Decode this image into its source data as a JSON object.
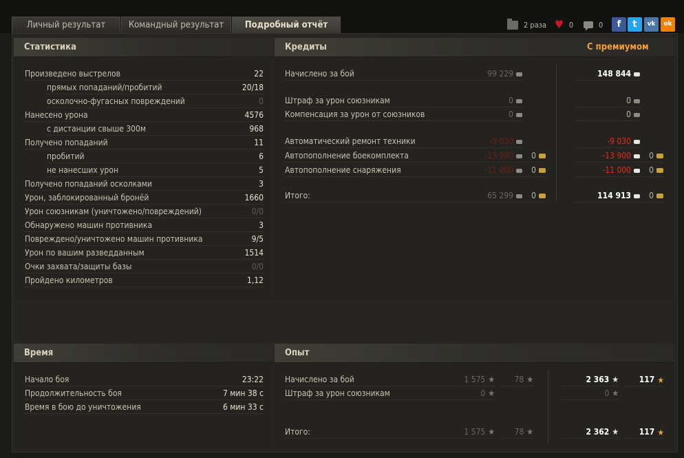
{
  "tabs": [
    "Личный результат",
    "Командный результат",
    "Подробный отчёт"
  ],
  "share": {
    "replays": "2 раза",
    "likes": "0",
    "comments": "0"
  },
  "social": [
    {
      "name": "facebook-icon",
      "glyph": "f",
      "color": "#3b5998"
    },
    {
      "name": "twitter-icon",
      "glyph": "t",
      "color": "#2aa3ef"
    },
    {
      "name": "vk-icon",
      "glyph": "vk",
      "color": "#4a76a8"
    },
    {
      "name": "odnoklassniki-icon",
      "glyph": "ok",
      "color": "#ee8208"
    }
  ],
  "stats": {
    "title": "Статистика",
    "rows": [
      {
        "label": "Произведено выстрелов",
        "value": "22"
      },
      {
        "label": "прямых попаданий/пробитий",
        "value": "20/18",
        "indent": true
      },
      {
        "label": "осколочно-фугасных повреждений",
        "value": "0",
        "indent": true,
        "dim": true
      },
      {
        "label": "Нанесено урона",
        "value": "4576"
      },
      {
        "label": "с дистанции свыше 300м",
        "value": "968",
        "indent": true
      },
      {
        "label": "Получено попаданий",
        "value": "11"
      },
      {
        "label": "пробитий",
        "value": "6",
        "indent": true
      },
      {
        "label": "не нанесших урон",
        "value": "5",
        "indent": true
      },
      {
        "label": "Получено попаданий осколками",
        "value": "3"
      },
      {
        "label": "Урон, заблокированный бронёй",
        "value": "1660"
      },
      {
        "label": "Урон союзникам (уничтожено/повреждений)",
        "value": "0/0",
        "dim": true
      },
      {
        "label": "Обнаружено машин противника",
        "value": "3"
      },
      {
        "label": "Повреждено/уничтожено машин противника",
        "value": "9/5"
      },
      {
        "label": "Урон по вашим разведданным",
        "value": "1514"
      },
      {
        "label": "Очки захвата/защиты базы",
        "value": "0/0",
        "dim": true
      },
      {
        "label": "Пройдено километров",
        "value": "1,12"
      }
    ]
  },
  "credits": {
    "title": "Кредиты",
    "premium_title": "С премиумом",
    "rows": [
      {
        "label": "Начислено за бой",
        "base": "99 229",
        "prem": "148 844",
        "kind": "main"
      },
      {
        "label": "Штраф за урон союзникам",
        "base": "0",
        "prem": "0",
        "kind": "zero"
      },
      {
        "label": "Компенсация за урон от союзников",
        "base": "0",
        "prem": "0",
        "kind": "zero"
      },
      {
        "label": "Автоматический ремонт техники",
        "base": "-9 030",
        "prem": "-9 030",
        "kind": "neg"
      },
      {
        "label": "Автопополнение боекомплекта",
        "base": "-13 900",
        "prem": "-13 900",
        "gold": "0",
        "kind": "neg"
      },
      {
        "label": "Автопополнение снаряжения",
        "base": "-11 000",
        "prem": "-11 000",
        "gold": "0",
        "kind": "neg"
      },
      {
        "label": "Итого:",
        "base": "65 299",
        "prem": "114 913",
        "gold": "0",
        "kind": "total"
      }
    ]
  },
  "time": {
    "title": "Время",
    "rows": [
      {
        "label": "Начало боя",
        "value": "23:22"
      },
      {
        "label": "Продолжительность боя",
        "value": "7 мин 38 с"
      },
      {
        "label": "Время в бою до уничтожения",
        "value": "6 мин 33 с"
      }
    ]
  },
  "exp": {
    "title": "Опыт",
    "rows": [
      {
        "label": "Начислено за бой",
        "base": "1 575",
        "base_free": "78",
        "prem": "2 363",
        "prem_free": "117"
      },
      {
        "label": "Штраф за урон союзникам",
        "base": "0",
        "prem": "0"
      },
      {
        "label": "Итого:",
        "base": "1 575",
        "base_free": "78",
        "prem": "2 362",
        "prem_free": "117"
      }
    ]
  }
}
